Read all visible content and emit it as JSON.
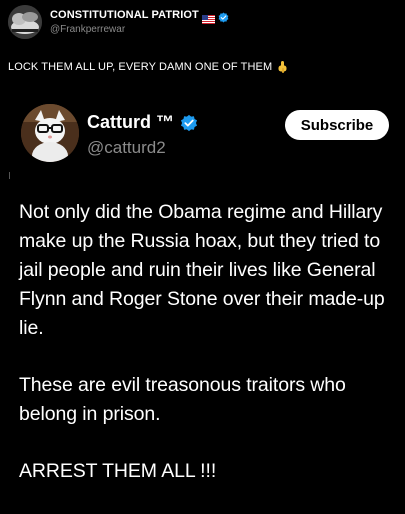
{
  "outer_post": {
    "display_name": "CONSTITUTIONAL PATRIOT",
    "handle": "@Frankperrewar",
    "flag_icon": "us-flag-icon",
    "verified_icon": "verified-badge-icon",
    "caption": "LOCK THEM ALL UP, EVERY DAMN ONE OF THEM",
    "caption_emoji": "pointing-down-hand-icon"
  },
  "quoted_post": {
    "display_name": "Catturd ™",
    "handle": "@catturd2",
    "verified_icon": "verified-badge-icon",
    "subscribe_label": "Subscribe",
    "paragraphs": [
      "Not only did the Obama regime and Hillary make up the Russia hoax, but they tried to jail people and ruin their lives like General Flynn and Roger Stone over their made-up lie.",
      "These are evil treasonous traitors who belong in prison.",
      "ARREST THEM ALL !!!"
    ]
  },
  "colors": {
    "background": "#000000",
    "text": "#ffffff",
    "secondary_text": "#8b8b8b",
    "verified_blue": "#1d9bf0",
    "button_bg": "#ffffff"
  }
}
